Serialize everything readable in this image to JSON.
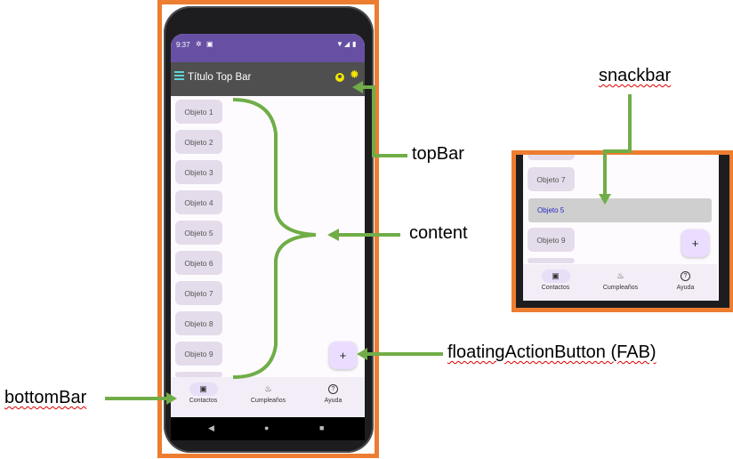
{
  "phone": {
    "status_time": "9:37",
    "topbar_title": "Título Top Bar",
    "items": [
      "Objeto 1",
      "Objeto 2",
      "Objeto 3",
      "Objeto 4",
      "Objeto 5",
      "Objeto 6",
      "Objeto 7",
      "Objeto 8",
      "Objeto 9"
    ],
    "fab_label": "+",
    "nav": [
      {
        "label": "Contactos",
        "icon": "contacts-icon",
        "selected": true
      },
      {
        "label": "Cumpleaños",
        "icon": "cake-icon",
        "selected": false
      },
      {
        "label": "Ayuda",
        "icon": "help-icon",
        "selected": false
      }
    ],
    "system_nav": [
      "◀",
      "●",
      "■"
    ]
  },
  "snack_example": {
    "items_above": [
      "Objeto 7"
    ],
    "snackbar_text": "Objeto 5",
    "items_below": [
      "Objeto 9"
    ],
    "fab_label": "+",
    "nav": [
      {
        "label": "Contactos",
        "icon": "contacts-icon",
        "selected": true
      },
      {
        "label": "Cumpleaños",
        "icon": "cake-icon",
        "selected": false
      },
      {
        "label": "Ayuda",
        "icon": "help-icon",
        "selected": false
      }
    ]
  },
  "annotations": {
    "topbar": "topBar",
    "content": "content",
    "fab": "floatingActionButton (FAB)",
    "bottombar": "bottomBar",
    "snackbar": "snackbar"
  },
  "colors": {
    "status_bar": "#6750A4",
    "top_bar": "#4f4f4f",
    "frame": "#ED7D31",
    "arrow": "#70AD47"
  }
}
